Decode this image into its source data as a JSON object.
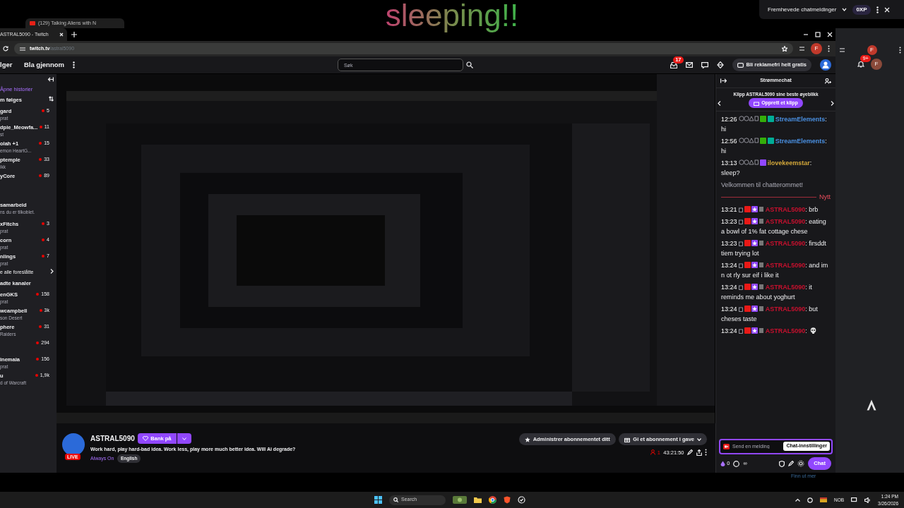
{
  "desktop": {
    "overlay_text": "sleeping!!",
    "back_tab": "(129) Talking Aliens with N",
    "popup": {
      "title": "Fremhevede chatmeldinger",
      "xp": "0XP"
    }
  },
  "browser": {
    "tab_title": "ASTRAL5090 - Twitch",
    "url_host": "twitch.tv",
    "url_path": "/astral5090",
    "avatar": "F"
  },
  "nav": {
    "links": [
      "lger",
      "Bla gjennom"
    ],
    "search_placeholder": "Søk",
    "notification_count": "17",
    "ad_free": "Bli reklamefri helt gratis"
  },
  "sidebar": {
    "stories": "Åpne historier",
    "followed_heading": "m følges",
    "followed": [
      {
        "name": "gard",
        "sub": "prat",
        "viewers": "5"
      },
      {
        "name": "dpie_Meowfa...",
        "sub": "st",
        "viewers": "11"
      },
      {
        "name": "olah +1",
        "sub": "emon HeartG...",
        "viewers": "15"
      },
      {
        "name": "ptemple",
        "sub": "ikk",
        "viewers": "33"
      },
      {
        "name": "yCore",
        "viewers": "89"
      }
    ],
    "collab": {
      "title": "samarbeid",
      "text": "ns du er tilkoblet."
    },
    "suggested": [
      {
        "name": "xFitchs",
        "sub": "prat",
        "viewers": "3"
      },
      {
        "name": "corn",
        "sub": "prat",
        "viewers": "4"
      },
      {
        "name": "nlings",
        "sub": "prat",
        "viewers": "7"
      }
    ],
    "see_all": "e alle foreslåtte",
    "recommended_heading": "adte kanaler",
    "recommended": [
      {
        "name": "enGKS",
        "sub": "prat",
        "viewers": "158"
      },
      {
        "name": "wcampbell",
        "sub": "son Desert",
        "viewers": "3k"
      },
      {
        "name": "phere",
        "sub": "Raiders",
        "viewers": "31"
      },
      {
        "viewers": "294"
      },
      {
        "name": "inemaia",
        "sub": "prat",
        "viewers": "156"
      },
      {
        "name": "u",
        "sub": "d of Warcraft",
        "viewers": "1,9k"
      }
    ]
  },
  "stream": {
    "kind": "picture",
    "channel": "ASTRAL5090",
    "live": "LIVE",
    "follow": "Bank på",
    "title": "Work hard, play hard-bad idea. Work less, play more much better idea. Will Ai degrade?",
    "category": "Always On",
    "tag": "English",
    "manage_sub": "Administrer abonnementet ditt",
    "gift_sub": "Gi et abonnement i gave",
    "viewers": "1",
    "uptime": "43:21:50"
  },
  "chat": {
    "title": "Strømmechat",
    "clip_prompt": "Klipp ASTRAL5090 sine beste øyeblikk",
    "clip_button": "Opprett et klipp",
    "messages": [
      {
        "kind": "bot",
        "time": "12:26",
        "user": "StreamElements",
        "color": "#4a90e2",
        "text": ": hi"
      },
      {
        "kind": "bot",
        "time": "12:56",
        "user": "StreamElements",
        "color": "#4a90e2",
        "text": ": hi"
      },
      {
        "kind": "viewer",
        "time": "13:13",
        "user": "ilovekeemstar",
        "color": "#d4a83a",
        "text": ": sleep?"
      },
      {
        "kind": "notice",
        "text": "Velkommen til chatterommet!"
      },
      {
        "kind": "divider",
        "text": "Nytt"
      },
      {
        "kind": "broadcaster",
        "time": "13:21",
        "user": "ASTRAL5090",
        "color": "#c8102e",
        "text": ": brb"
      },
      {
        "kind": "broadcaster",
        "time": "13:23",
        "user": "ASTRAL5090",
        "color": "#c8102e",
        "text": ": eating a bowl of 1% fat cottage chese"
      },
      {
        "kind": "broadcaster",
        "time": "13:23",
        "user": "ASTRAL5090",
        "color": "#c8102e",
        "text": ": firsddt tiem trying lot"
      },
      {
        "kind": "broadcaster",
        "time": "13:24",
        "user": "ASTRAL5090",
        "color": "#c8102e",
        "text": ": and im n ot rly sur eif i like it"
      },
      {
        "kind": "broadcaster",
        "time": "13:24",
        "user": "ASTRAL5090",
        "color": "#c8102e",
        "text": ": it reminds me about yoghurt"
      },
      {
        "kind": "broadcaster",
        "time": "13:24",
        "user": "ASTRAL5090",
        "color": "#c8102e",
        "text": ": but cheses taste"
      },
      {
        "kind": "broadcaster",
        "time": "13:24",
        "user": "ASTRAL5090",
        "color": "#c8102e",
        "text": ":",
        "emote": true
      }
    ],
    "input_placeholder": "Send en melding",
    "tooltip": "Chat-innstillinger",
    "points": "0",
    "infinity": "∞",
    "send": "Chat"
  },
  "back_window": {
    "toolbar_avatar": "F",
    "notification_count": "9+",
    "avatar": "F",
    "link": "Finn ut mer"
  },
  "taskbar": {
    "search": "Search",
    "language": "NOB",
    "time": "1:24 PM",
    "date": "3/26/2026"
  }
}
